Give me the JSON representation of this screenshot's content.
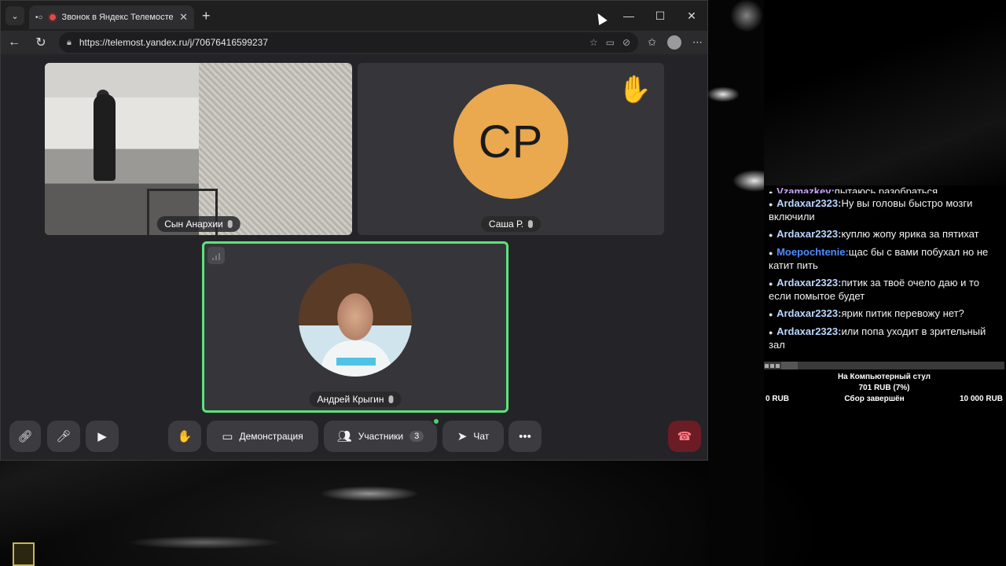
{
  "browser": {
    "tab": {
      "title": "Звонок в Яндекс Телемосте",
      "close": "✕"
    },
    "new_tab": "+",
    "window_controls": {
      "minimize": "—",
      "maximize": "☐",
      "close": "✕"
    },
    "nav": {
      "back": "←",
      "reload": "↻"
    },
    "url": "https://telemost.yandex.ru/j/70676416599237"
  },
  "call": {
    "tiles": [
      {
        "name": "Сын Анархии",
        "type": "video"
      },
      {
        "name": "Саша Р.",
        "type": "avatar",
        "initials": "СР",
        "avatar_color": "#eaa84f",
        "raised_hand": "✋"
      },
      {
        "name": "Андрей Крыгин",
        "type": "video",
        "speaking_border": "#5be37b"
      }
    ],
    "controls": {
      "hand_icon": "✋",
      "demo_label": "Демонстрация",
      "participants_label": "Участники",
      "participants_count": "3",
      "chat_label": "Чат",
      "more_icon": "•••"
    }
  },
  "chat": {
    "messages": [
      {
        "nick": "Vzamazkev:",
        "text": "пытаюсь разобраться",
        "nick_color": "#c9a4ff"
      },
      {
        "nick": "Ardaxar2323:",
        "text": "Ну вы головы быстро мозги включили",
        "nick_color": "#b9d7ff"
      },
      {
        "nick": "Ardaxar2323:",
        "text": "куплю жопу ярика за пятихат",
        "nick_color": "#b9d7ff"
      },
      {
        "nick": "Moepochtenie:",
        "text": "щас бы с вами побухал но не катит пить",
        "nick_color": "#4f8cff"
      },
      {
        "nick": "Ardaxar2323:",
        "text": "питик за твоё очело даю и то если помытое будет",
        "nick_color": "#b9d7ff"
      },
      {
        "nick": "Ardaxar2323:",
        "text": "ярик питик перевожу нет?",
        "nick_color": "#b9d7ff"
      },
      {
        "nick": "Ardaxar2323:",
        "text": "или попа уходит в зрительный зал",
        "nick_color": "#b9d7ff"
      }
    ]
  },
  "donation": {
    "title": "На Компьютерный стул",
    "raised": "701 RUB (7%)",
    "progress": 0.07,
    "min": "0 RUB",
    "status": "Сбор завершён",
    "goal": "10 000 RUB"
  }
}
